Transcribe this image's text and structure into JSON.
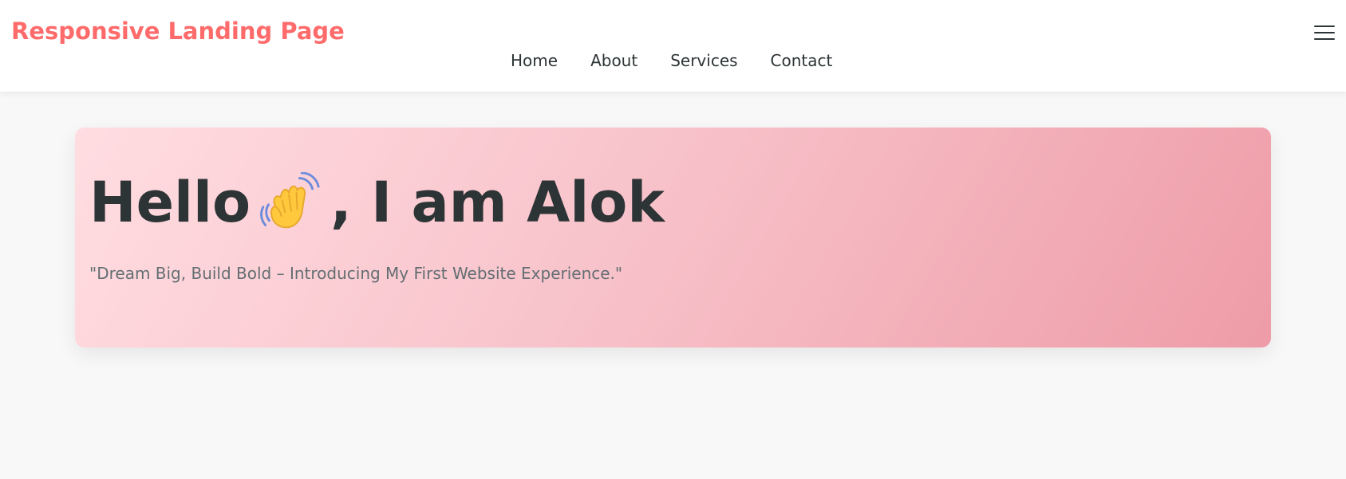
{
  "header": {
    "brand": "Responsive Landing Page",
    "nav": [
      {
        "label": "Home"
      },
      {
        "label": "About"
      },
      {
        "label": "Services"
      },
      {
        "label": "Contact"
      }
    ],
    "menu_icon": "menu-icon"
  },
  "hero": {
    "title_before_icon": "Hello",
    "title_icon": "waving-hand-icon",
    "title_after_icon": ", I am Alok",
    "subtitle": "\"Dream Big, Build Bold – Introducing My First Website Experience.\""
  },
  "colors": {
    "brand": "#ff6b6b",
    "text": "#2d3436",
    "subtitle": "#636e72",
    "background": "#f8f8f8",
    "hero_gradient_start": "#ffdde1",
    "hero_gradient_end": "#ee9ca7"
  }
}
